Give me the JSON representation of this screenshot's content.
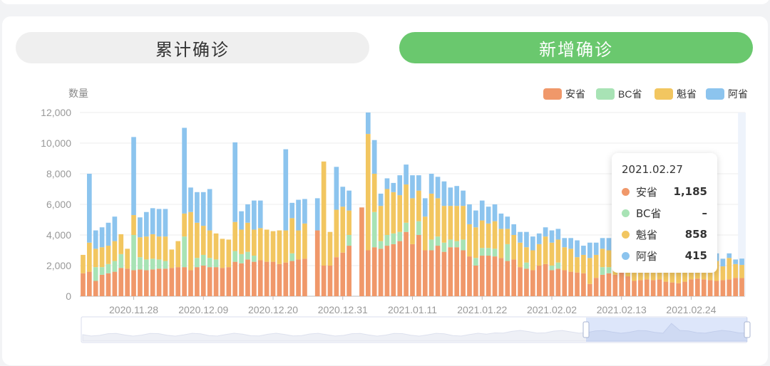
{
  "tabs": {
    "cumulative": "累计确诊",
    "new": "新增确诊"
  },
  "colors": {
    "安省": "#f0986a",
    "BC省": "#a8e3b5",
    "魁省": "#f2c660",
    "阿省": "#8cc4ee",
    "active_tab": "#6ac86e"
  },
  "tooltip": {
    "date": "2021.02.27",
    "rows": [
      {
        "name": "安省",
        "value": "1,185"
      },
      {
        "name": "BC省",
        "value": "–"
      },
      {
        "name": "魁省",
        "value": "858"
      },
      {
        "name": "阿省",
        "value": "415"
      }
    ]
  },
  "chart_data": {
    "type": "bar",
    "stacked": true,
    "ylabel": "数量",
    "ylim": [
      0,
      12000
    ],
    "yticks": [
      "0",
      "2,000",
      "4,000",
      "6,000",
      "8,000",
      "10,000",
      "12,000"
    ],
    "xticks": [
      "2020.11.28",
      "2020.12.09",
      "2020.12.20",
      "2020.12.31",
      "2021.01.11",
      "2021.01.22",
      "2021.02.02",
      "2021.02.13",
      "2021.02.24"
    ],
    "legend": [
      "安省",
      "BC省",
      "魁省",
      "阿省"
    ],
    "legend_position": "top-right",
    "x_start": "2020.11.20",
    "x_end": "2021.02.28",
    "highlighted_category": "2021.02.27",
    "series": [
      {
        "name": "安省",
        "values": [
          1500,
          1600,
          1000,
          1400,
          1500,
          1600,
          1850,
          1800,
          1700,
          1750,
          1700,
          1750,
          1800,
          1800,
          1850,
          1900,
          1900,
          1700,
          1900,
          2000,
          1900,
          1900,
          1850,
          1900,
          2250,
          2150,
          2400,
          2250,
          2350,
          2250,
          2250,
          2100,
          2200,
          2300,
          2400,
          2450,
          null,
          4300,
          2000,
          2000,
          2550,
          2850,
          3300,
          null,
          5800,
          3000,
          3200,
          3100,
          3300,
          3400,
          3600,
          4200,
          3400,
          4000,
          3000,
          3000,
          3300,
          2900,
          3200,
          3200,
          3000,
          2600,
          2000,
          2650,
          2650,
          2600,
          2500,
          2300,
          2400,
          1900,
          1800,
          1700,
          2000,
          2100,
          1700,
          1800,
          1700,
          1600,
          1550,
          1500,
          800,
          1200,
          1400,
          1500,
          1400,
          1600,
          1300,
          1000,
          1050,
          1100,
          1050,
          1100,
          950,
          900,
          850,
          950,
          1100,
          1150,
          1100,
          1050,
          1000,
          1050,
          1100,
          1200,
          1185
        ]
      },
      {
        "name": "BC省",
        "values": [
          0,
          0,
          900,
          500,
          600,
          700,
          900,
          0,
          2300,
          800,
          700,
          700,
          600,
          500,
          0,
          0,
          2000,
          0,
          600,
          700,
          600,
          500,
          0,
          0,
          700,
          600,
          500,
          400,
          0,
          0,
          0,
          0,
          0,
          500,
          0,
          0,
          null,
          0,
          0,
          0,
          0,
          0,
          700,
          null,
          0,
          0,
          2300,
          500,
          700,
          700,
          600,
          600,
          0,
          900,
          0,
          700,
          600,
          600,
          500,
          400,
          700,
          0,
          500,
          500,
          500,
          500,
          0,
          1100,
          0,
          0,
          400,
          0,
          0,
          0,
          300,
          400,
          0,
          0,
          0,
          0,
          0,
          0,
          500,
          400,
          0,
          0,
          0,
          0,
          0,
          0,
          0,
          0,
          0,
          0,
          0,
          0,
          0,
          0,
          0,
          0,
          0,
          0,
          0,
          0,
          0
        ]
      },
      {
        "name": "魁省",
        "values": [
          1200,
          1900,
          1200,
          1300,
          1200,
          1300,
          1300,
          1300,
          1300,
          1300,
          1500,
          1600,
          1500,
          1600,
          1200,
          1700,
          1500,
          3800,
          2300,
          1900,
          1800,
          1700,
          1900,
          1800,
          1900,
          1600,
          1900,
          1700,
          2100,
          2100,
          2000,
          2200,
          2100,
          2300,
          1900,
          2300,
          null,
          0,
          6800,
          2200,
          3100,
          3000,
          1600,
          null,
          0,
          7600,
          2500,
          2300,
          3000,
          2700,
          2400,
          2500,
          3000,
          2000,
          2200,
          3000,
          2500,
          2400,
          2200,
          2300,
          2200,
          2100,
          2000,
          1800,
          1600,
          1800,
          1900,
          1000,
          1600,
          1600,
          1000,
          1300,
          1400,
          1800,
          1500,
          1500,
          1500,
          1500,
          1000,
          1200,
          1700,
          1500,
          1200,
          1100,
          1200,
          1200,
          1400,
          1200,
          1200,
          1100,
          1100,
          1100,
          1200,
          1200,
          1100,
          1100,
          1000,
          1000,
          1200,
          1300,
          1300,
          900,
          1400,
          900,
          858
        ]
      },
      {
        "name": "阿省",
        "values": [
          0,
          4500,
          1200,
          1300,
          1500,
          1600,
          0,
          0,
          5100,
          1300,
          1600,
          1700,
          1800,
          1800,
          0,
          0,
          5600,
          1600,
          2000,
          2200,
          2700,
          0,
          0,
          0,
          5200,
          1200,
          1200,
          1900,
          1800,
          0,
          0,
          0,
          5300,
          1000,
          2000,
          1600,
          null,
          2100,
          0,
          0,
          2800,
          1300,
          1300,
          null,
          0,
          1400,
          2200,
          800,
          700,
          600,
          1300,
          1300,
          1500,
          1000,
          1200,
          1300,
          1400,
          1600,
          1200,
          1300,
          1000,
          1300,
          1100,
          1300,
          1100,
          1100,
          1000,
          800,
          700,
          700,
          1000,
          900,
          700,
          600,
          800,
          700,
          600,
          700,
          1100,
          600,
          1000,
          800,
          700,
          800,
          400,
          600,
          700,
          600,
          400,
          300,
          700,
          300,
          400,
          400,
          300,
          500,
          300,
          400,
          300,
          400,
          500,
          500,
          300,
          300,
          415
        ]
      }
    ]
  }
}
